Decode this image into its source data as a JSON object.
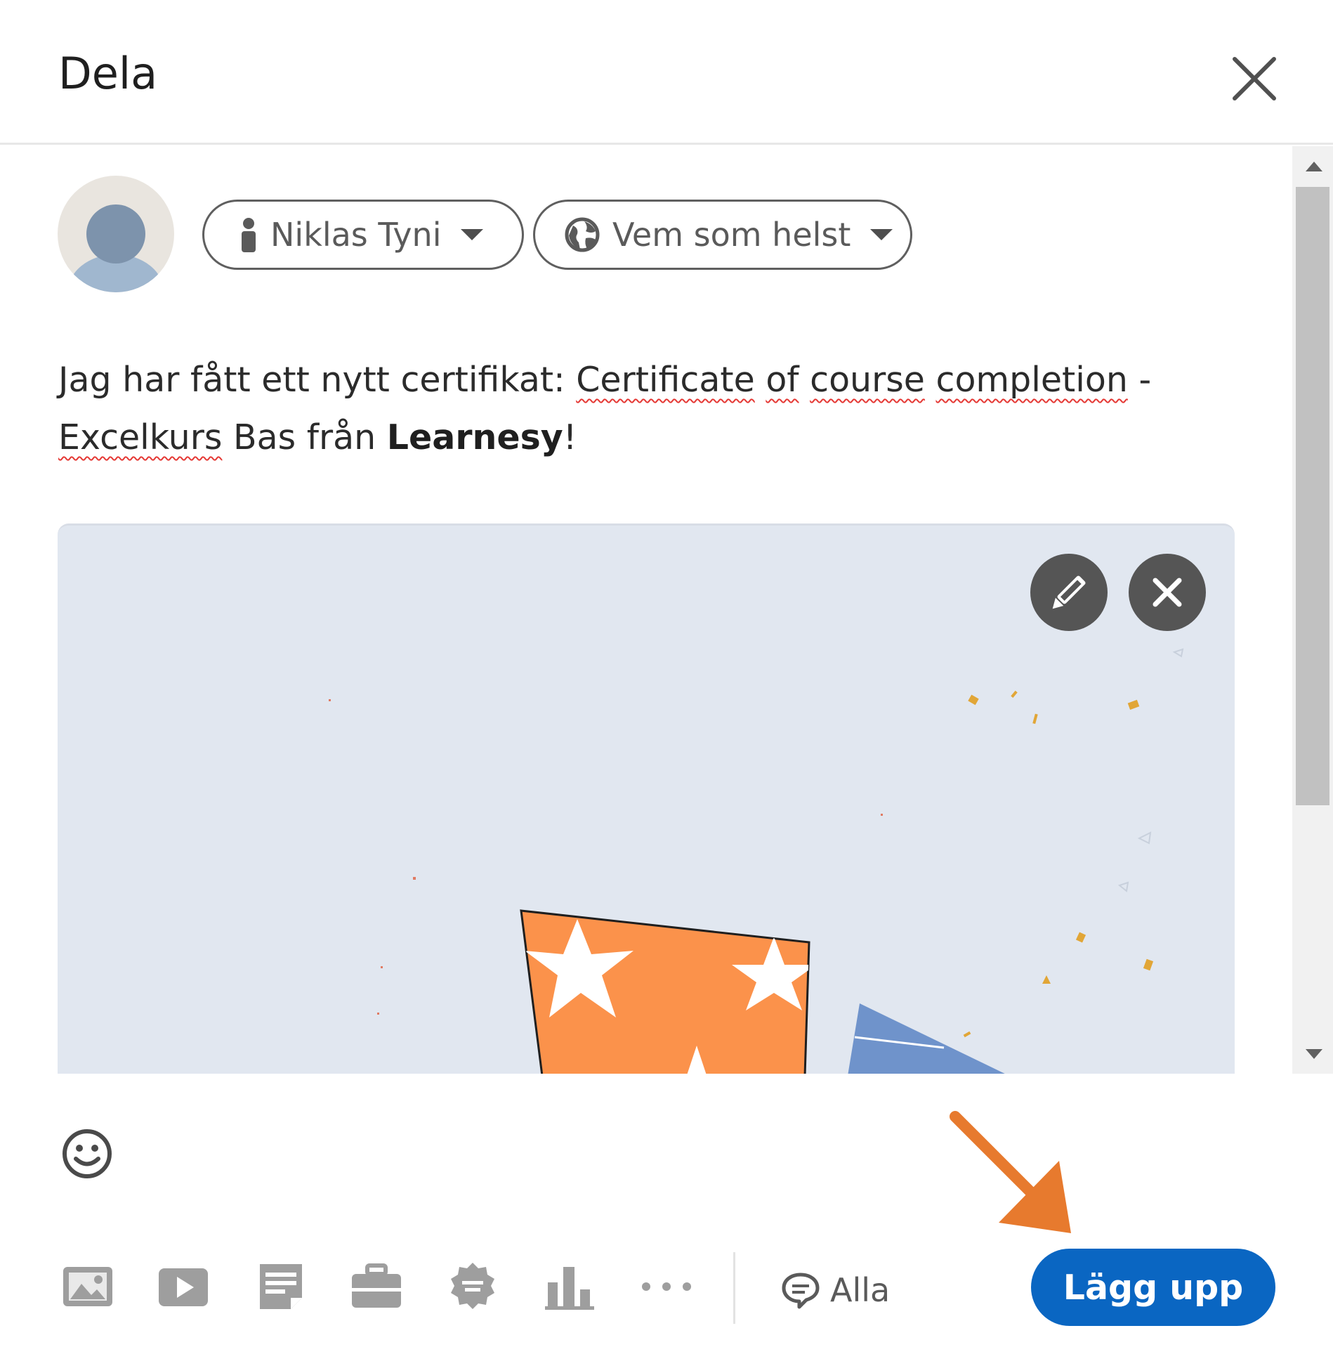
{
  "dialog": {
    "title": "Dela"
  },
  "composer": {
    "author_label": "Niklas Tyni",
    "visibility_label": "Vem som helst",
    "text": {
      "part1": "Jag har fått ett nytt certifikat: ",
      "w1": "Certificate",
      "w2": "of",
      "w3": "course",
      "w4": "completion",
      "sep": " - ",
      "w5": "Excelkurs",
      "part2": " Bas från ",
      "org": "Learnesy",
      "end": "!"
    }
  },
  "toolbar": {
    "icons": [
      "photo-icon",
      "video-icon",
      "document-icon",
      "job-icon",
      "celebrate-icon",
      "poll-icon",
      "more-icon"
    ],
    "comment_setting_label": "Alla",
    "post_button_label": "Lägg upp"
  },
  "colors": {
    "primary": "#0a66c2",
    "image_background": "#e1e7f0",
    "annotation_arrow": "#e77a2e",
    "star_orange": "#fb924b",
    "triangle_blue": "#6f93cb"
  }
}
